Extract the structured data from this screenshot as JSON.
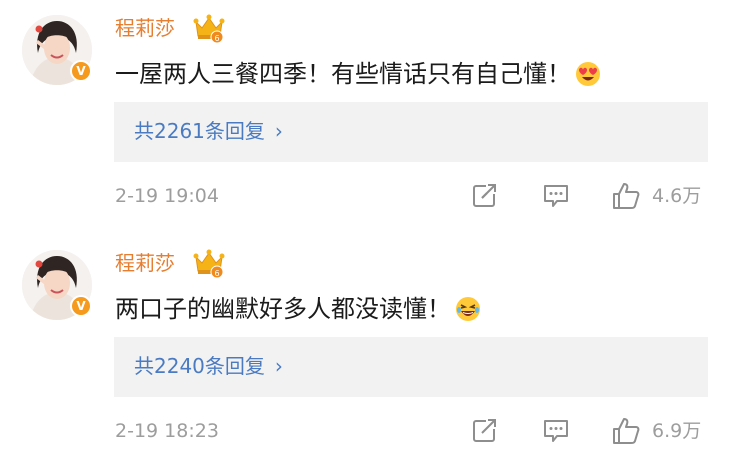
{
  "colors": {
    "name": "#e77d2f",
    "link": "#4a7bc2",
    "meta": "#9d9d9d",
    "text": "#1b1b1b",
    "reply_bg": "#f2f2f2",
    "badge": "#f59a1c"
  },
  "comments": [
    {
      "author": "程莉莎",
      "avatar_badge": "V",
      "text": "一屋两人三餐四季！有些情话只有自己懂！",
      "emoji_icon": "heart-eyes-emoji-icon",
      "replies_label": "共2261条回复",
      "time": "2-19 19:04",
      "likes": "4.6万"
    },
    {
      "author": "程莉莎",
      "avatar_badge": "V",
      "text": "两口子的幽默好多人都没读懂！",
      "emoji_icon": "laughing-emoji-icon",
      "replies_label": "共2240条回复",
      "time": "2-19 18:23",
      "likes": "6.9万"
    }
  ]
}
